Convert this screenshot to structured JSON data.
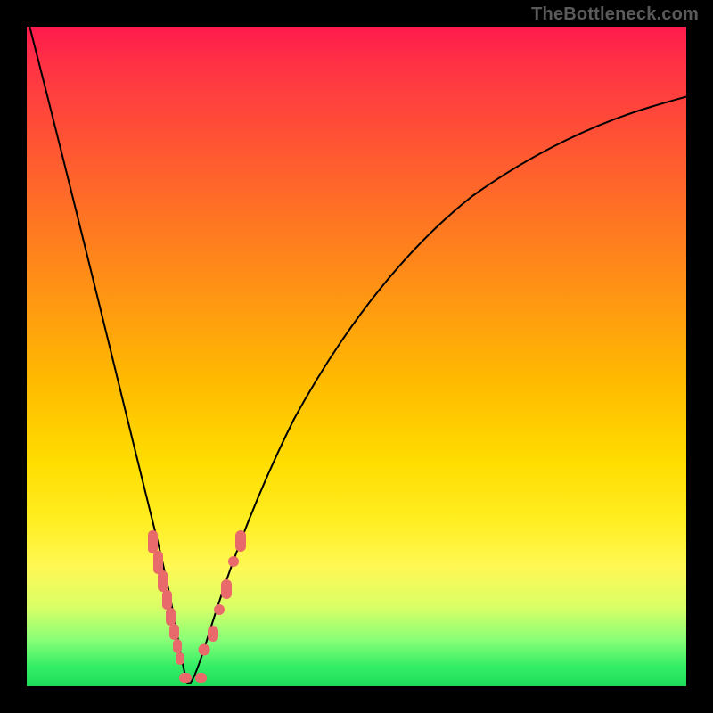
{
  "watermark": "TheBottleneck.com",
  "colors": {
    "marker": "#e96a6a",
    "curve": "#000000",
    "frame": "#000000"
  },
  "chart_data": {
    "type": "line",
    "title": "",
    "xlabel": "",
    "ylabel": "",
    "xlim": [
      0,
      100
    ],
    "ylim": [
      0,
      100
    ],
    "grid": false,
    "legend": false,
    "notes": "Bottleneck percentage curve; V-shaped dip with minimum at roughly 24% of x-range. Values below are estimated from the plotted curve (y = % bottleneck, x = arbitrary relative axis 0–100).",
    "series": [
      {
        "name": "bottleneck_pct",
        "x": [
          0,
          4,
          8,
          12,
          16,
          18,
          20,
          22,
          24,
          26,
          28,
          30,
          32,
          36,
          40,
          48,
          56,
          64,
          72,
          80,
          88,
          96,
          100
        ],
        "y": [
          100,
          85,
          70,
          54,
          37,
          28,
          19,
          10,
          2,
          3,
          10,
          18,
          26,
          39,
          49,
          63,
          72,
          78,
          82,
          85,
          87,
          89,
          90
        ]
      }
    ],
    "markers": {
      "note": "pink sample markers near the trough, estimated x positions",
      "left_cluster_x": [
        18.5,
        19.5,
        20.4,
        21.1,
        21.7,
        22.2
      ],
      "right_cluster_x": [
        26.1,
        27.4,
        28.8,
        30.1,
        31.3
      ],
      "bottom_bar_x": [
        22.8,
        25.3
      ]
    }
  }
}
